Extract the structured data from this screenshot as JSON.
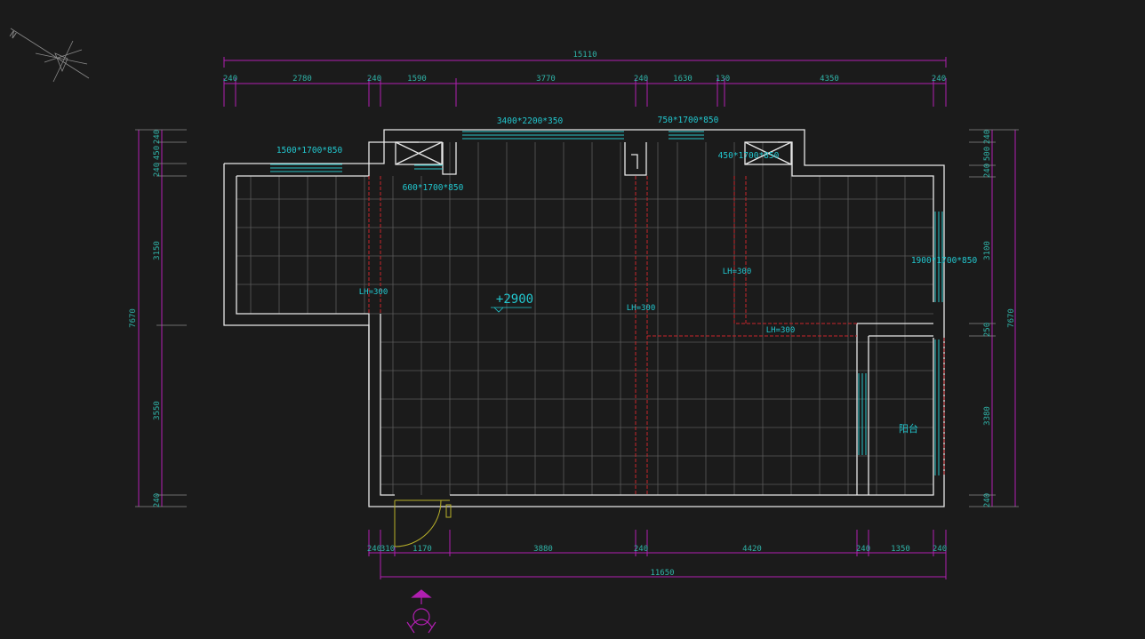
{
  "overall": {
    "top": "15110",
    "bottom": "11650",
    "left": "7670",
    "right": "7670"
  },
  "top_segments": [
    "240",
    "2780",
    "240",
    "1590",
    "3770",
    "240",
    "1630",
    "130",
    "4350",
    "240"
  ],
  "bottom_segments": [
    "240",
    "310",
    "1170",
    "3880",
    "240",
    "4420",
    "240",
    "1350",
    "240"
  ],
  "left_segments": [
    "240",
    "450",
    "240",
    "3150",
    "3550",
    "240"
  ],
  "right_segments": [
    "240",
    "500",
    "240",
    "3100",
    "250",
    "3380",
    "240"
  ],
  "window_specs": [
    "1500*1700*850",
    "3400*2200*350",
    "750*1700*850",
    "450*1700*850",
    "600*1700*850",
    "1900*1700*850"
  ],
  "beam_labels": [
    "LH=300",
    "LH=300",
    "LH=300",
    "LH=300"
  ],
  "elevation": "+2900",
  "room_label": "阳台",
  "colors": {
    "background": "#1b1b1b",
    "dimension": "#b01fb0",
    "dim_text": "#2fb3a8",
    "wall": "#e8e8e8",
    "grid": "#5a5a5a",
    "beam": "#c8262b",
    "window": "#27c6c9"
  },
  "icons": [
    "compass-icon",
    "entrance-marker-icon"
  ]
}
